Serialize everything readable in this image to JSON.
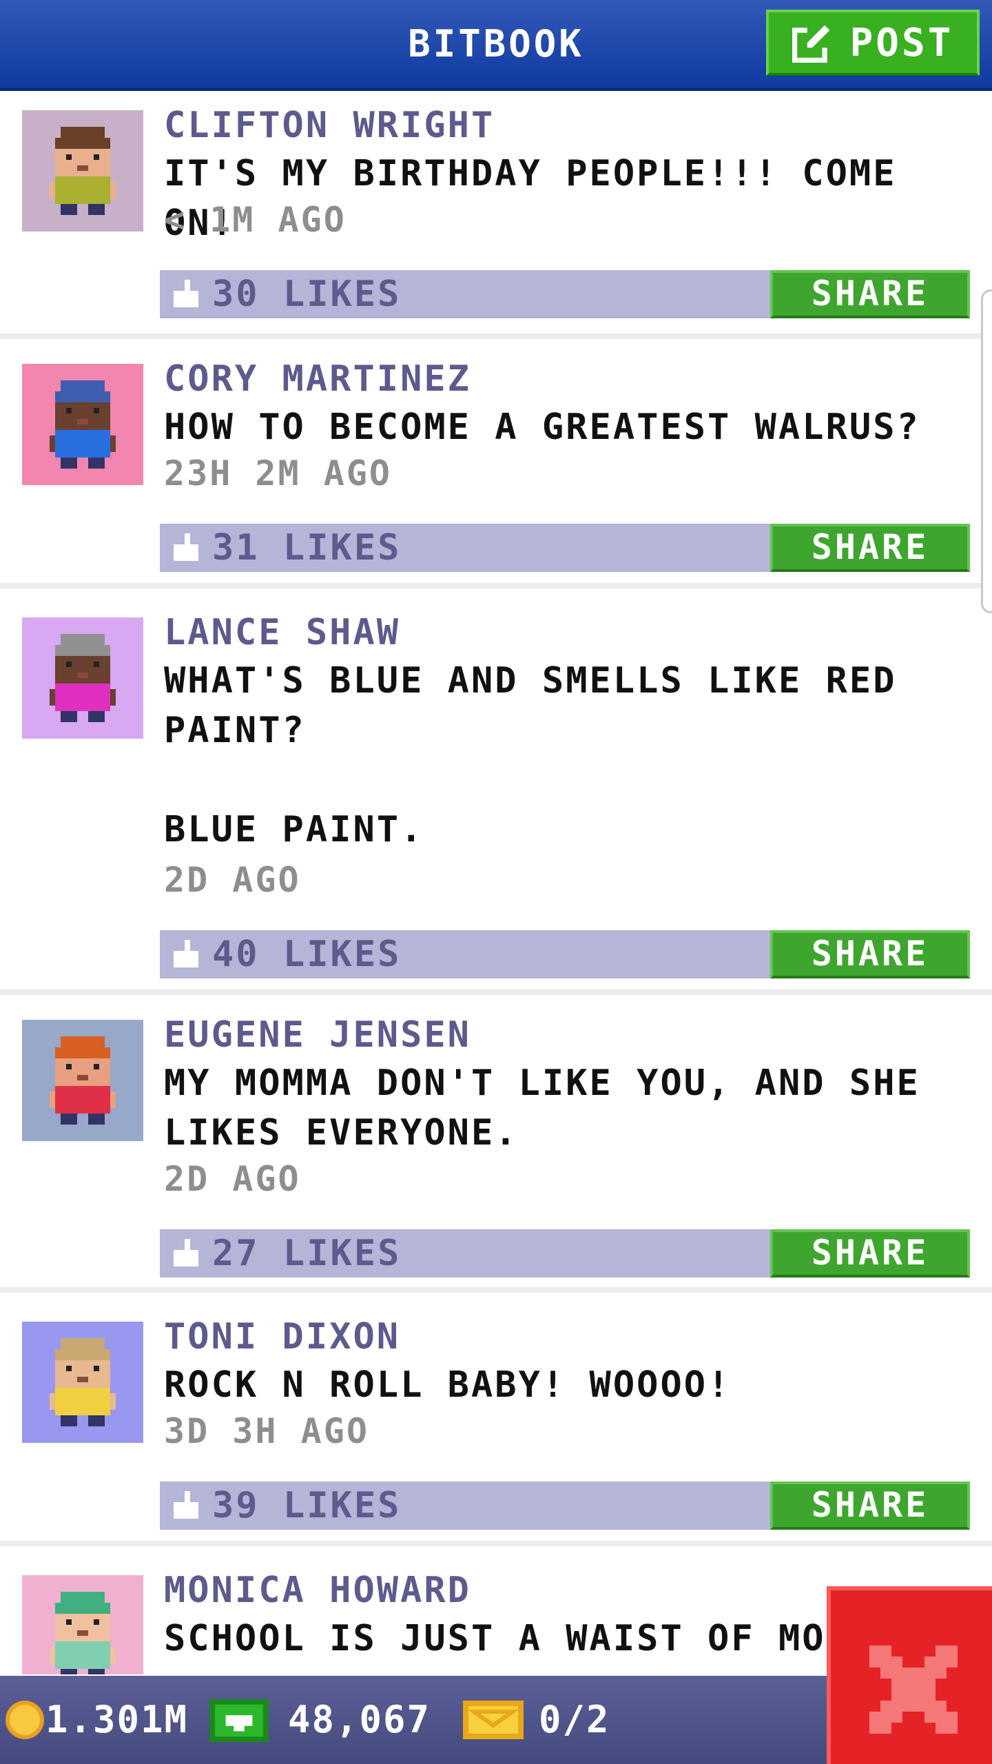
{
  "header": {
    "title": "BITBOOK",
    "post_label": "POST"
  },
  "posts": [
    {
      "name": "CLIFTON WRIGHT",
      "message": "IT'S MY BIRTHDAY PEOPLE!!! COME ON!",
      "time": "< 1M AGO",
      "likes": "30 LIKES",
      "share": "SHARE",
      "avatar_bg": "#c8b0c8",
      "shirt": "#aab030",
      "skin": "#e8b08c",
      "hair": "#6a4028"
    },
    {
      "name": "CORY MARTINEZ",
      "message": "HOW TO BECOME A GREATEST WALRUS?",
      "time": "23H 2M AGO",
      "likes": "31 LIKES",
      "share": "SHARE",
      "avatar_bg": "#f386ae",
      "shirt": "#2a6fe0",
      "skin": "#6a4030",
      "hair": "#3e5eb0"
    },
    {
      "name": "LANCE SHAW",
      "message": "WHAT'S BLUE AND SMELLS LIKE RED PAINT?\n\nBLUE PAINT.",
      "time": "2D AGO",
      "likes": "40 LIKES",
      "share": "SHARE",
      "avatar_bg": "#d8a8f2",
      "shirt": "#e030c0",
      "skin": "#6a4030",
      "hair": "#909090"
    },
    {
      "name": "EUGENE JENSEN",
      "message": "MY MOMMA DON'T LIKE YOU, AND SHE LIKES EVERYONE.",
      "time": "2D AGO",
      "likes": "27 LIKES",
      "share": "SHARE",
      "avatar_bg": "#98a8c8",
      "shirt": "#e03048",
      "skin": "#e8a080",
      "hair": "#d86020"
    },
    {
      "name": "TONI DIXON",
      "message": "ROCK N ROLL BABY! WOOOO!",
      "time": "3D 3H AGO",
      "likes": "39 LIKES",
      "share": "SHARE",
      "avatar_bg": "#9898f0",
      "shirt": "#f0d040",
      "skin": "#e8b890",
      "hair": "#c8a870"
    },
    {
      "name": "MONICA HOWARD",
      "message": "SCHOOL IS JUST A WAIST OF MO",
      "time": "",
      "likes": "",
      "share": "",
      "avatar_bg": "#f0b0d0",
      "shirt": "#80d0b0",
      "skin": "#f0c0a0",
      "hair": "#40b080"
    }
  ],
  "bottom": {
    "coins": "1.301M",
    "bux": "48,067",
    "tickets": "0/2"
  },
  "colors": {
    "header": "#1b44a8",
    "post_button": "#38b020",
    "like_bar": "#b5b5d8",
    "share_button": "#3ea62e",
    "close_button": "#e52326",
    "bottom_bar": "#4f5388"
  }
}
